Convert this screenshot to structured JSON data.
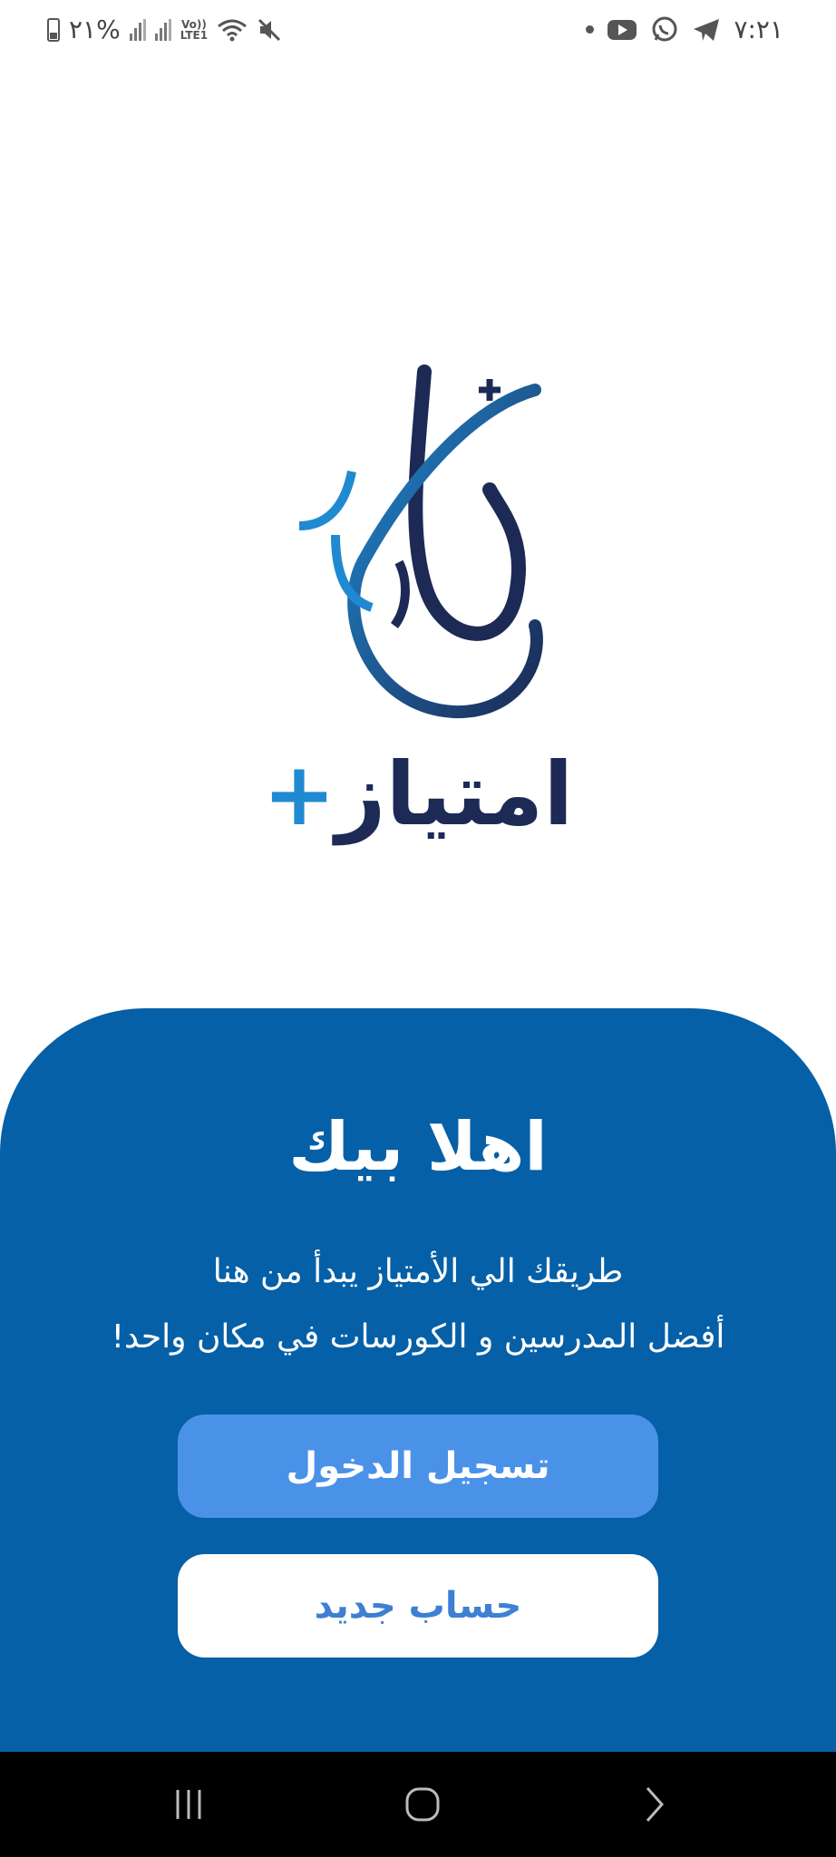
{
  "status_bar": {
    "battery_text": "٢١%",
    "time": "٧:٢١",
    "volte_top": "Vo))",
    "volte_bottom": "LTE1"
  },
  "logo": {
    "wordmark": "امتياز",
    "plus": "+"
  },
  "welcome": {
    "title": "اهلا بيك",
    "line1": "طريقك الي الأمتياز يبدأ من هنا",
    "line2": "أفضل المدرسين و الكورسات في مكان واحد!"
  },
  "buttons": {
    "login_label": "تسجيل الدخول",
    "signup_label": "حساب جديد"
  },
  "colors": {
    "panel": "#0560a7",
    "login_button": "#4a92e8",
    "signup_text": "#3d80d4",
    "logo_dark": "#1c2a55",
    "logo_light": "#1f8ad1"
  },
  "icons": {
    "status_left": [
      "battery-icon",
      "signal-icon",
      "signal-icon",
      "volte-icon",
      "wifi-icon",
      "mute-icon"
    ],
    "status_right": [
      "notification-dot-icon",
      "youtube-icon",
      "whatsapp-icon",
      "telegram-icon"
    ],
    "nav": [
      "recent-apps-icon",
      "home-icon",
      "back-icon"
    ]
  }
}
